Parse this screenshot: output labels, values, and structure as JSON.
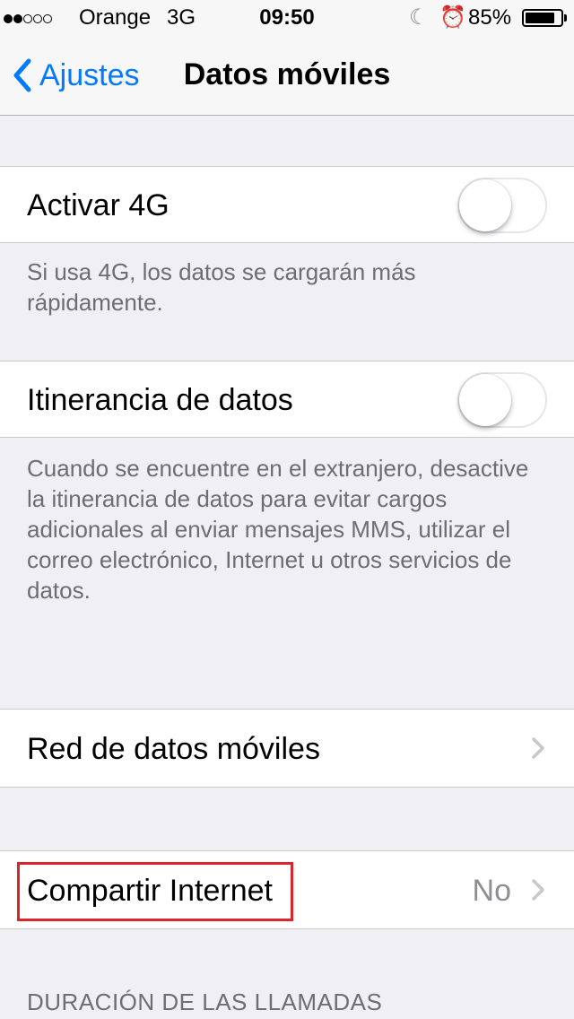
{
  "status_bar": {
    "carrier": "Orange",
    "network": "3G",
    "time": "09:50",
    "battery": "85%",
    "battery_level": 0.85,
    "signal_bars_filled": 2,
    "signal_bars_total": 5
  },
  "nav": {
    "back_label": "Ajustes",
    "title": "Datos móviles"
  },
  "settings": {
    "activar_4g": {
      "label": "Activar 4G",
      "on": false,
      "footer": "Si usa 4G, los datos se cargarán más rápidamente."
    },
    "itinerancia": {
      "label": "Itinerancia de datos",
      "on": false,
      "footer": "Cuando se encuentre en el extranjero, desactive la itinerancia de datos para evitar cargos adicionales al enviar mensajes MMS, utilizar el correo electrónico, Internet u otros servicios de datos."
    },
    "red_datos": {
      "label": "Red de datos móviles"
    },
    "compartir": {
      "label": "Compartir Internet",
      "value": "No"
    }
  },
  "section_header": "DURACIÓN DE LAS LLAMADAS",
  "colors": {
    "accent": "#007aff",
    "background": "#efeff4",
    "highlight": "#d9252b"
  }
}
